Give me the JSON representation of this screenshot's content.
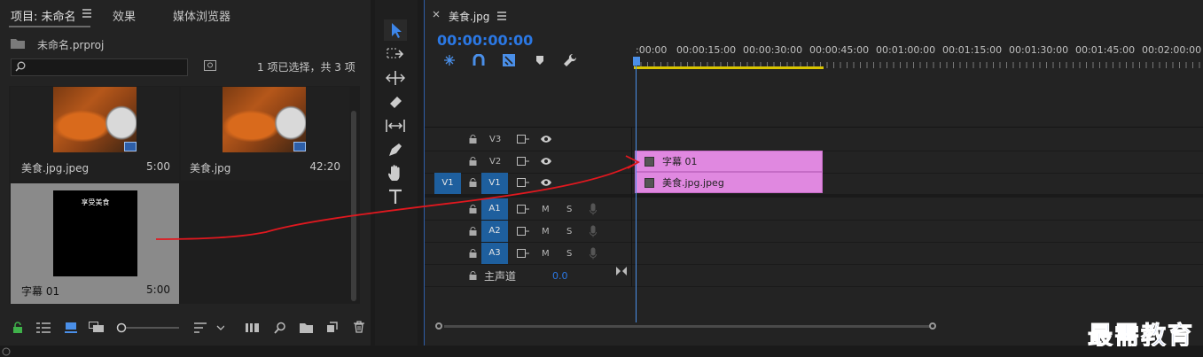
{
  "project_panel": {
    "tab_project": "项目: 未命名",
    "tab_effects": "效果",
    "tab_media_browser": "媒体浏览器",
    "project_file": "未命名.prproj",
    "selection_status": "1 项已选择，共 3 项",
    "items": [
      {
        "label": "美食.jpg.jpeg",
        "duration": "5:00"
      },
      {
        "label": "美食.jpg",
        "duration": "42:20"
      },
      {
        "label": "字幕 01",
        "duration": "5:00",
        "thumb_text": "享受美食"
      }
    ]
  },
  "timeline": {
    "tab_title": "美食.jpg",
    "timecode": "00:00:00:00",
    "ruler_labels": [
      ":00:00",
      "00:00:15:00",
      "00:00:30:00",
      "00:00:45:00",
      "00:01:00:00",
      "00:01:15:00",
      "00:01:30:00",
      "00:01:45:00",
      "00:02:00:00"
    ],
    "video_tracks": [
      "V3",
      "V2",
      "V1"
    ],
    "source_patch": "V1",
    "audio_tracks": [
      "A1",
      "A2",
      "A3"
    ],
    "mute_label": "M",
    "solo_label": "S",
    "master_label": "主声道",
    "master_value": "0.0",
    "clips": [
      {
        "track": "V2",
        "name": "字幕 01"
      },
      {
        "track": "V1",
        "name": "美食.jpg.jpeg"
      }
    ]
  },
  "watermark": "最需教育",
  "colors": {
    "accent_blue": "#2b78e4",
    "clip_pink": "#e088e0",
    "playhead_blue": "#4a8fe8",
    "annotation_red": "#e0181f",
    "work_area_yellow": "#d8c400"
  }
}
